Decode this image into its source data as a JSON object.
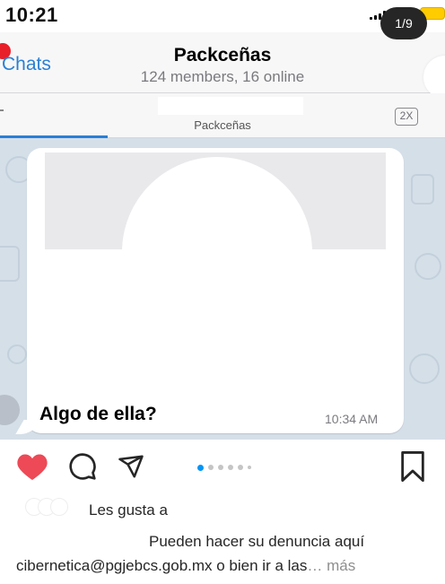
{
  "status_bar": {
    "time": "10:21"
  },
  "telegram": {
    "nav": {
      "back_label": "Chats",
      "title": "Packceñas",
      "subtitle": "124 members, 16 online"
    },
    "pinned": {
      "name": "Packceñas",
      "speed": "2X"
    },
    "message": {
      "text": "Algo de ella?",
      "time": "10:34 AM"
    }
  },
  "carousel": {
    "counter": "1/9"
  },
  "post": {
    "likes_text": "Les gusta a",
    "caption_line1": "Pueden hacer su denuncia aquí",
    "caption_line2": "cibernetica@pgjebcs.gob.mx o bien ir a las",
    "ellipsis": "…",
    "more_label": " más"
  },
  "colors": {
    "accent_blue": "#2a7fd4",
    "like_red": "#ed4956",
    "battery_yellow": "#ffcc00",
    "carousel_active": "#0095f6"
  }
}
